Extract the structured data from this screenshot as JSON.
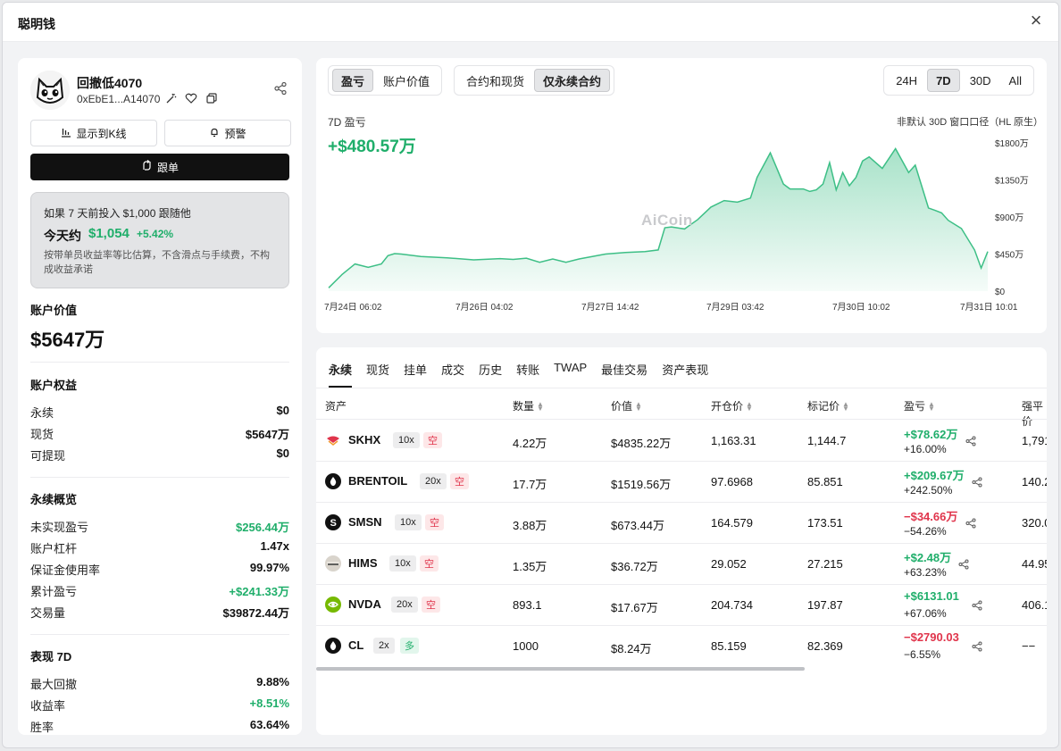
{
  "window": {
    "title": "聪明钱",
    "close_icon": "close-icon"
  },
  "profile": {
    "name": "回撤低4070",
    "address": "0xEbE1...A14070",
    "show_kline_label": "显示到K线",
    "alert_label": "预警",
    "follow_label": "跟单"
  },
  "simulation": {
    "question": "如果 7 天前投入 $1,000 跟随他",
    "today_label": "今天约",
    "amount": "$1,054",
    "pct": "+5.42%",
    "note": "按带单员收益率等比估算，不含滑点与手续费，不构成收益承诺"
  },
  "account": {
    "value_label": "账户价值",
    "value": "$5647万",
    "equity_label": "账户权益",
    "equity": [
      {
        "k": "永续",
        "v": "$0"
      },
      {
        "k": "现货",
        "v": "$5647万"
      },
      {
        "k": "可提现",
        "v": "$0"
      }
    ],
    "perp_label": "永续概览",
    "perp": [
      {
        "k": "未实现盈亏",
        "v": "$256.44万",
        "color": "green"
      },
      {
        "k": "账户杠杆",
        "v": "1.47x",
        "color": ""
      },
      {
        "k": "保证金使用率",
        "v": "99.97%",
        "color": ""
      },
      {
        "k": "累计盈亏",
        "v": "+$241.33万",
        "color": "green"
      },
      {
        "k": "交易量",
        "v": "$39872.44万",
        "color": ""
      }
    ],
    "perf_label": "表现 7D",
    "perf": [
      {
        "k": "最大回撤",
        "v": "9.88%",
        "color": ""
      },
      {
        "k": "收益率",
        "v": "+8.51%",
        "color": "green"
      },
      {
        "k": "胜率",
        "v": "63.64%",
        "color": ""
      }
    ]
  },
  "chart_panel": {
    "metric_tabs": [
      "盈亏",
      "账户价值"
    ],
    "metric_active": 0,
    "scope_tabs": [
      "合约和现货",
      "仅永续合约"
    ],
    "scope_active": 1,
    "range_tabs": [
      "24H",
      "7D",
      "30D",
      "All"
    ],
    "range_active": 1,
    "title": "7D 盈亏",
    "total": "+$480.57万",
    "note": "非默认 30D 窗口口径（HL 原生）",
    "watermark": "AiCoin"
  },
  "chart_data": {
    "type": "area",
    "title": "7D 盈亏",
    "y_tick_labels": [
      "$1800万",
      "$1350万",
      "$900万",
      "$450万",
      "$0"
    ],
    "x_tick_labels": [
      "7月24日 06:02",
      "7月26日 04:02",
      "7月27日 14:42",
      "7月29日 03:42",
      "7月30日 10:02",
      "7月31日 10:01"
    ],
    "ylim": [
      0,
      1800
    ],
    "xlim": [
      0,
      100
    ],
    "y_unit": "万",
    "grid": false,
    "color": "#3dbf86",
    "series": [
      {
        "x": [
          0,
          2,
          4,
          6,
          8,
          9,
          10,
          11,
          14,
          18,
          22,
          26,
          28,
          30,
          32,
          34,
          36,
          38,
          40,
          42,
          45,
          48,
          50,
          51,
          52,
          54,
          56,
          58,
          60,
          62,
          64,
          65,
          67,
          69,
          70,
          72,
          73,
          74,
          75,
          76,
          77,
          78,
          79,
          80,
          81,
          82,
          84,
          86,
          88,
          89,
          91,
          92,
          93,
          94,
          96,
          98,
          99,
          100
        ],
        "y": [
          40,
          200,
          330,
          290,
          330,
          430,
          455,
          450,
          420,
          405,
          380,
          395,
          385,
          400,
          350,
          390,
          350,
          390,
          420,
          450,
          470,
          480,
          500,
          770,
          780,
          755,
          870,
          1020,
          1100,
          1080,
          1130,
          1380,
          1680,
          1300,
          1240,
          1240,
          1210,
          1230,
          1300,
          1560,
          1230,
          1440,
          1280,
          1380,
          1580,
          1630,
          1490,
          1730,
          1440,
          1530,
          1010,
          980,
          950,
          860,
          760,
          500,
          280,
          480
        ]
      }
    ]
  },
  "positions": {
    "tabs": [
      "永续",
      "现货",
      "挂单",
      "成交",
      "历史",
      "转账",
      "TWAP",
      "最佳交易",
      "资产表现"
    ],
    "tab_active": 0,
    "headers": [
      "资产",
      "数量",
      "价值",
      "开仓价",
      "标记价",
      "盈亏",
      "强平价"
    ],
    "rows": [
      {
        "asset": "SKHX",
        "lev": "10x",
        "side": "空",
        "side_type": "short",
        "qty": "4.22万",
        "value": "$4835.22万",
        "entry": "1,163.31",
        "mark": "1,144.7",
        "pnl": "+$78.62万",
        "pnl_pct": "+16.00%",
        "pnl_type": "pos",
        "liq": "1,791.",
        "icon": "skhx-logo-icon",
        "icon_color": "#e0344b"
      },
      {
        "asset": "BRENTOIL",
        "lev": "20x",
        "side": "空",
        "side_type": "short",
        "qty": "17.7万",
        "value": "$1519.56万",
        "entry": "97.6968",
        "mark": "85.851",
        "pnl": "+$209.67万",
        "pnl_pct": "+242.50%",
        "pnl_type": "pos",
        "liq": "140.2",
        "icon": "oil-drop-icon",
        "icon_color": "#111111"
      },
      {
        "asset": "SMSN",
        "lev": "10x",
        "side": "空",
        "side_type": "short",
        "qty": "3.88万",
        "value": "$673.44万",
        "entry": "164.579",
        "mark": "173.51",
        "pnl": "−$34.66万",
        "pnl_pct": "−54.26%",
        "pnl_type": "neg",
        "liq": "320.0",
        "icon": "smsn-logo-icon",
        "icon_color": "#111111"
      },
      {
        "asset": "HIMS",
        "lev": "10x",
        "side": "空",
        "side_type": "short",
        "qty": "1.35万",
        "value": "$36.72万",
        "entry": "29.052",
        "mark": "27.215",
        "pnl": "+$2.48万",
        "pnl_pct": "+63.23%",
        "pnl_type": "pos",
        "liq": "44.95",
        "icon": "hims-logo-icon",
        "icon_color": "#d9d4cc"
      },
      {
        "asset": "NVDA",
        "lev": "20x",
        "side": "空",
        "side_type": "short",
        "qty": "893.1",
        "value": "$17.67万",
        "entry": "204.734",
        "mark": "197.87",
        "pnl": "+$6131.01",
        "pnl_pct": "+67.06%",
        "pnl_type": "pos",
        "liq": "406.1",
        "icon": "nvda-logo-icon",
        "icon_color": "#76b900"
      },
      {
        "asset": "CL",
        "lev": "2x",
        "side": "多",
        "side_type": "long",
        "qty": "1000",
        "value": "$8.24万",
        "entry": "85.159",
        "mark": "82.369",
        "pnl": "−$2790.03",
        "pnl_pct": "−6.55%",
        "pnl_type": "neg",
        "liq": "−−",
        "icon": "oil-drop-icon",
        "icon_color": "#111111"
      }
    ]
  }
}
